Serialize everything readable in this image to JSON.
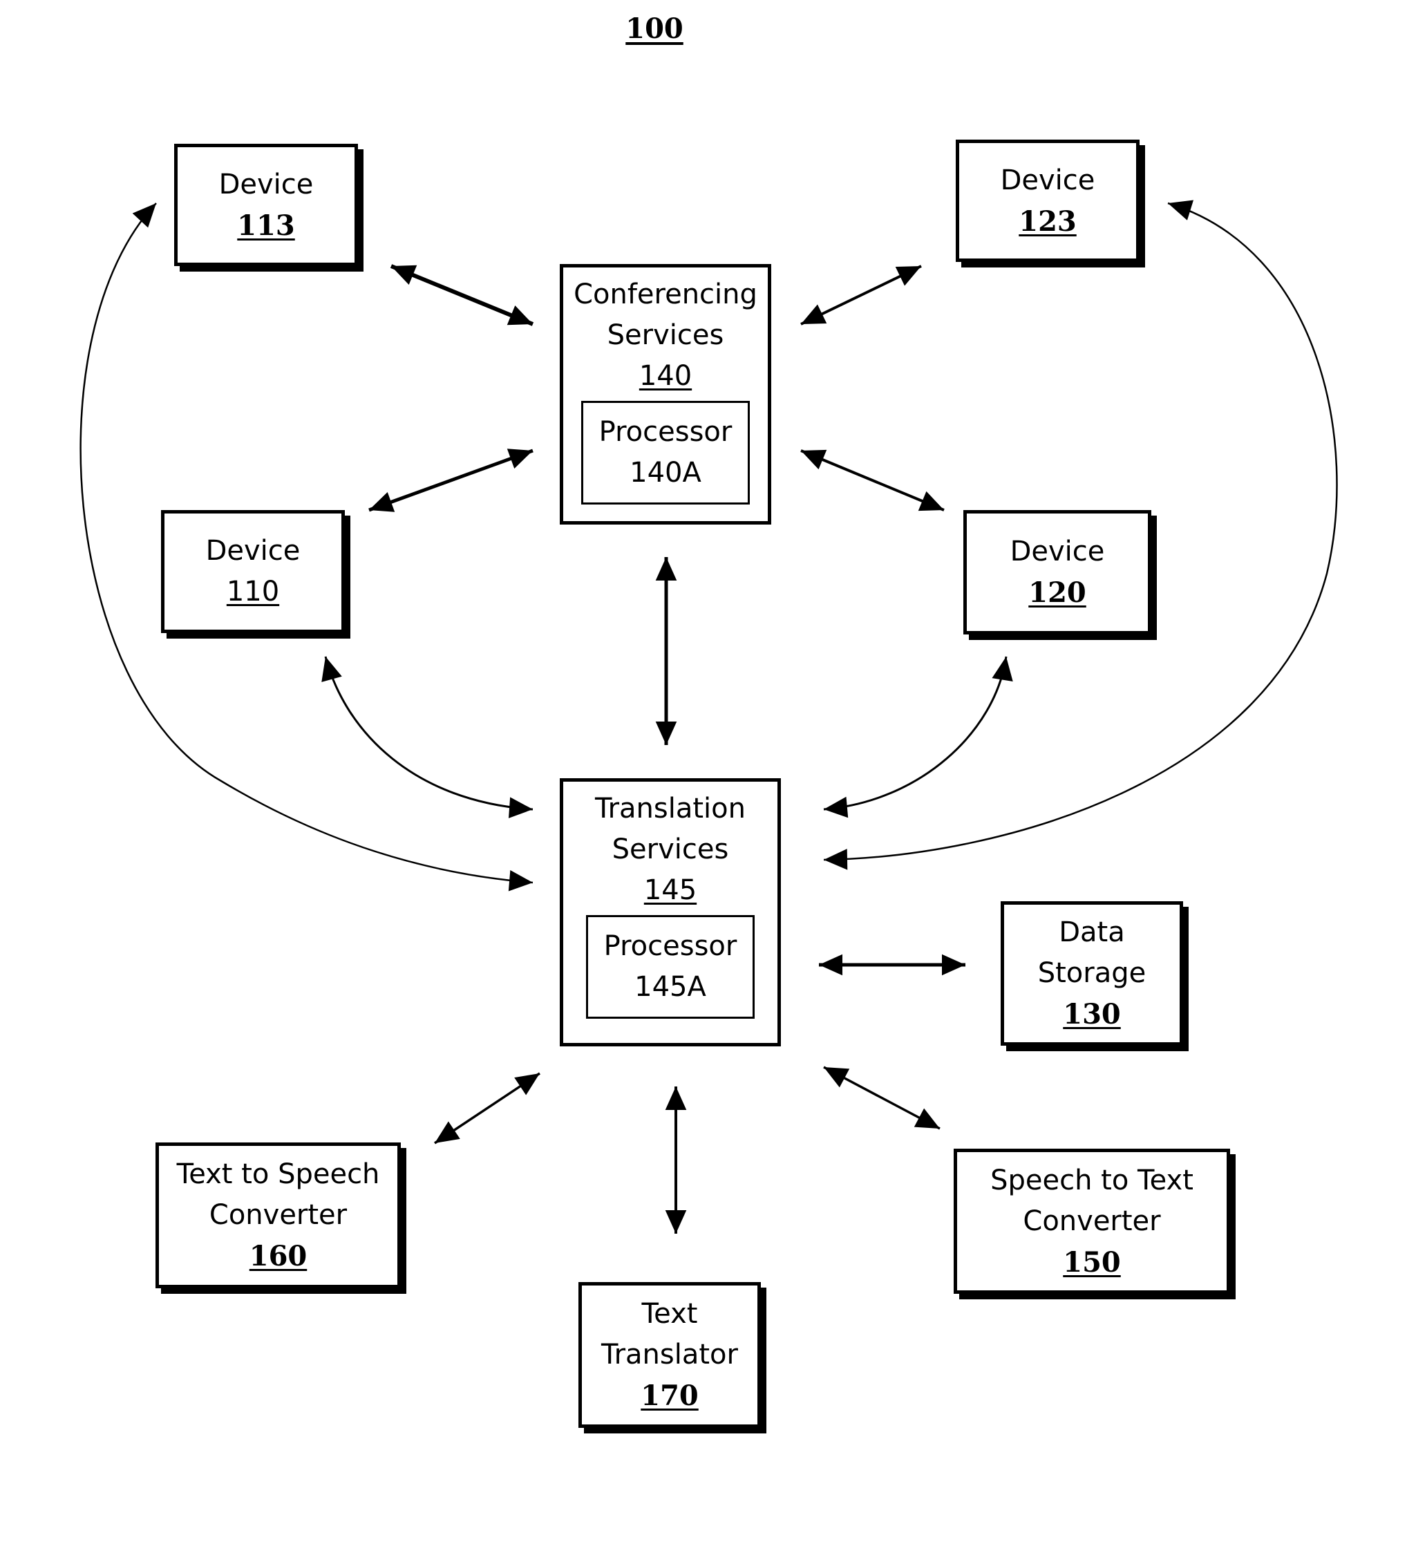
{
  "figure": {
    "number": "100"
  },
  "nodes": {
    "device_113": {
      "label": "Device",
      "number": "113"
    },
    "device_123": {
      "label": "Device",
      "number": "123"
    },
    "device_110": {
      "label": "Device",
      "number": "110"
    },
    "device_120": {
      "label": "Device",
      "number": "120"
    },
    "conferencing": {
      "line1": "Conferencing",
      "line2": "Services",
      "number": "140",
      "processor": {
        "label": "Processor",
        "number": "140A"
      }
    },
    "translation": {
      "line1": "Translation",
      "line2": "Services",
      "number": "145",
      "processor": {
        "label": "Processor",
        "number": "145A"
      }
    },
    "data_storage": {
      "line1": "Data",
      "line2": "Storage",
      "number": "130"
    },
    "tts": {
      "line1": "Text to Speech",
      "line2": "Converter",
      "number": "160"
    },
    "translator": {
      "line1": "Text",
      "line2": "Translator",
      "number": "170"
    },
    "stt": {
      "line1": "Speech to Text",
      "line2": "Converter",
      "number": "150"
    }
  },
  "connections": [
    {
      "from": "113",
      "to": "140",
      "bidirectional": true,
      "style": "straight"
    },
    {
      "from": "123",
      "to": "140",
      "bidirectional": true,
      "style": "straight"
    },
    {
      "from": "110",
      "to": "140",
      "bidirectional": true,
      "style": "straight"
    },
    {
      "from": "120",
      "to": "140",
      "bidirectional": true,
      "style": "straight"
    },
    {
      "from": "140",
      "to": "145",
      "bidirectional": true,
      "style": "straight"
    },
    {
      "from": "110",
      "to": "145",
      "bidirectional": true,
      "style": "curved"
    },
    {
      "from": "120",
      "to": "145",
      "bidirectional": true,
      "style": "curved"
    },
    {
      "from": "113",
      "to": "145",
      "bidirectional": true,
      "style": "curved"
    },
    {
      "from": "123",
      "to": "145",
      "bidirectional": true,
      "style": "curved"
    },
    {
      "from": "145",
      "to": "130",
      "bidirectional": true,
      "style": "straight"
    },
    {
      "from": "145",
      "to": "160",
      "bidirectional": true,
      "style": "straight"
    },
    {
      "from": "145",
      "to": "170",
      "bidirectional": true,
      "style": "straight"
    },
    {
      "from": "145",
      "to": "150",
      "bidirectional": true,
      "style": "straight"
    }
  ]
}
